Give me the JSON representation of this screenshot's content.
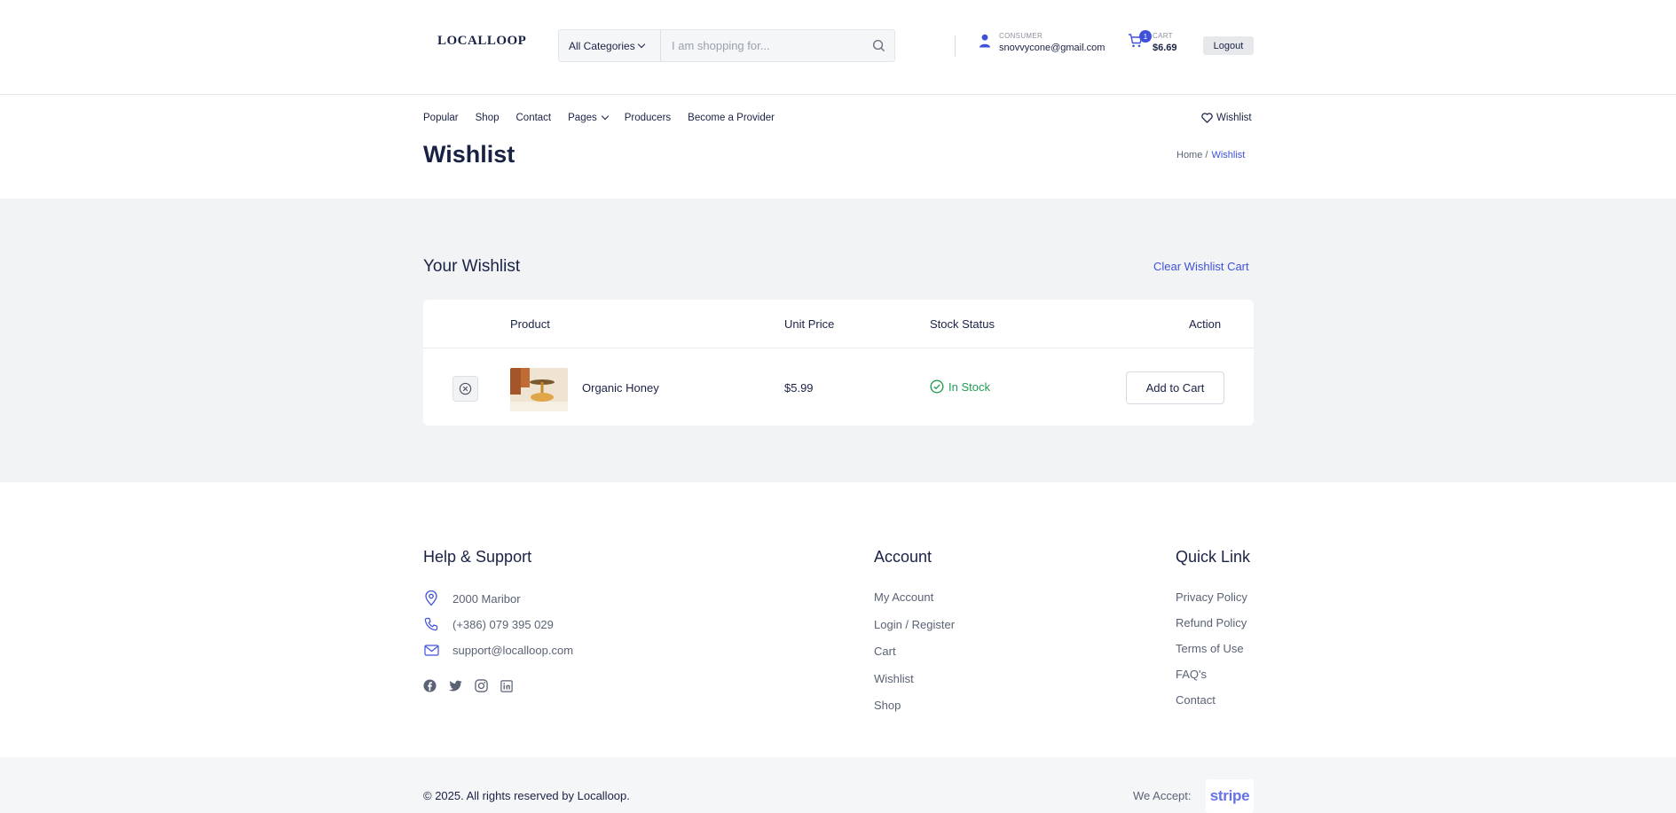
{
  "header": {
    "logo": "LOCALLOOP",
    "search": {
      "category": "All Categories",
      "placeholder": "I am shopping for..."
    },
    "user": {
      "role": "CONSUMER",
      "email": "snovvycone@gmail.com"
    },
    "cart": {
      "label": "CART",
      "count": "1",
      "total": "$6.69"
    },
    "logout_label": "Logout"
  },
  "nav": {
    "items": [
      "Popular",
      "Shop",
      "Contact",
      "Pages",
      "Producers",
      "Become a Provider"
    ],
    "wishlist_label": "Wishlist"
  },
  "page": {
    "title": "Wishlist",
    "breadcrumb": {
      "home": "Home /",
      "current": "Wishlist"
    }
  },
  "wishlist": {
    "title": "Your Wishlist",
    "clear_label": "Clear Wishlist Cart",
    "columns": [
      "Product",
      "Unit Price",
      "Stock Status",
      "Action"
    ],
    "rows": [
      {
        "product": "Organic Honey",
        "price": "$5.99",
        "stock": "In Stock",
        "action": "Add to Cart"
      }
    ]
  },
  "footer": {
    "help": {
      "title": "Help & Support",
      "address": "2000 Maribor",
      "phone": "(+386) 079 395 029",
      "email": "support@localloop.com"
    },
    "account": {
      "title": "Account",
      "links": [
        "My Account",
        "Login / Register",
        "Cart",
        "Wishlist",
        "Shop"
      ]
    },
    "quick": {
      "title": "Quick Link",
      "links": [
        "Privacy Policy",
        "Refund Policy",
        "Terms of Use",
        "FAQ's",
        "Contact"
      ]
    },
    "social_icons": [
      "facebook-icon",
      "twitter-icon",
      "instagram-icon",
      "linkedin-icon"
    ],
    "copyright": "© 2025. All rights reserved by Localloop.",
    "accept_label": "We Accept:",
    "payment": "stripe"
  },
  "colors": {
    "accent": "#3f51d9",
    "text": "#1a2244",
    "success": "#1f9d55",
    "section_bg": "#f2f3f5"
  }
}
